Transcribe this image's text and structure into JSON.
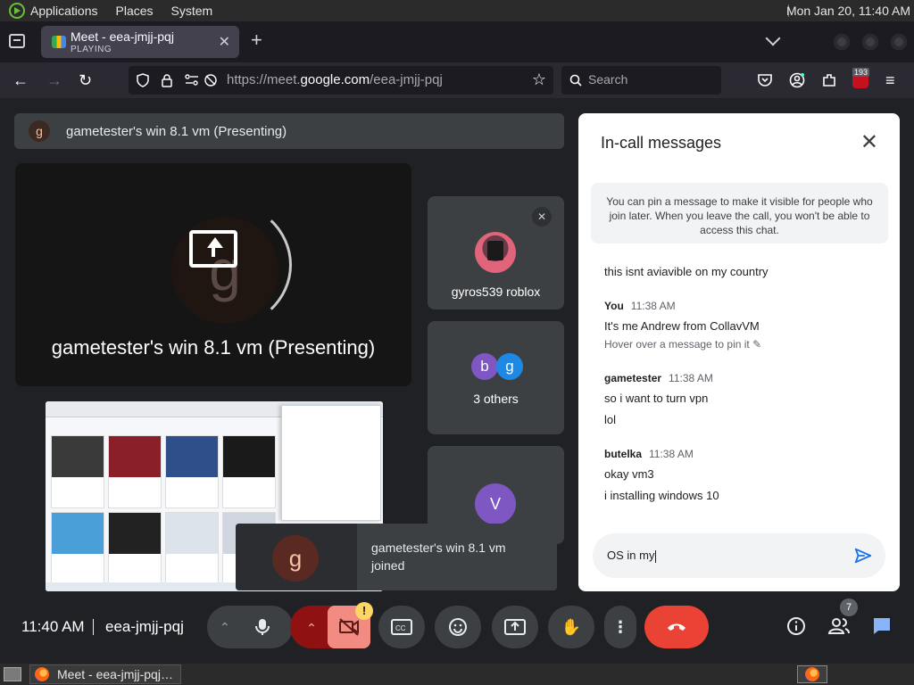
{
  "os": {
    "menus": [
      "Applications",
      "Places",
      "System"
    ],
    "clock": "Mon Jan 20, 11:40 AM"
  },
  "browser": {
    "tab_title": "Meet - eea-jmjj-pqj",
    "tab_status": "PLAYING",
    "url_prefix": "https://meet.",
    "url_domain": "google.com",
    "url_path": "/eea-jmjj-pqj",
    "search_placeholder": "Search",
    "extension_badge": "193"
  },
  "meet": {
    "pinned_label": "gametester's win 8.1 vm (Presenting)",
    "pinned_initial": "g",
    "presenting_label": "gametester's win 8.1 vm (Presenting)",
    "participants": [
      {
        "name": "gyros539 roblox"
      },
      {
        "name": "3 others",
        "initials": [
          "b",
          "g"
        ]
      },
      {
        "initial": "V"
      }
    ],
    "toast": {
      "initial": "g",
      "text": "gametester's win 8.1 vm joined"
    },
    "time": "11:40 AM",
    "code": "eea-jmjj-pqj",
    "people_count": "7",
    "colors": {
      "accent": "#1a73e8",
      "end_call": "#ea4335",
      "camera_off": "#f28b82"
    }
  },
  "chat": {
    "title": "In-call messages",
    "info": "You can pin a message to make it visible for people who join later. When you leave the call, you won't be able to access this chat.",
    "partial_message": "this isnt aviavible on my country",
    "groups": [
      {
        "sender": "You",
        "time": "11:38 AM",
        "messages": [
          "It's me Andrew from CollavVM"
        ],
        "hint": "Hover over a message to pin it"
      },
      {
        "sender": "gametester",
        "time": "11:38 AM",
        "messages": [
          "so i want to turn vpn",
          "lol"
        ]
      },
      {
        "sender": "butelka",
        "time": "11:38 AM",
        "messages": [
          "okay vm3",
          "i installing windows 10"
        ]
      }
    ],
    "draft": "OS in my"
  }
}
